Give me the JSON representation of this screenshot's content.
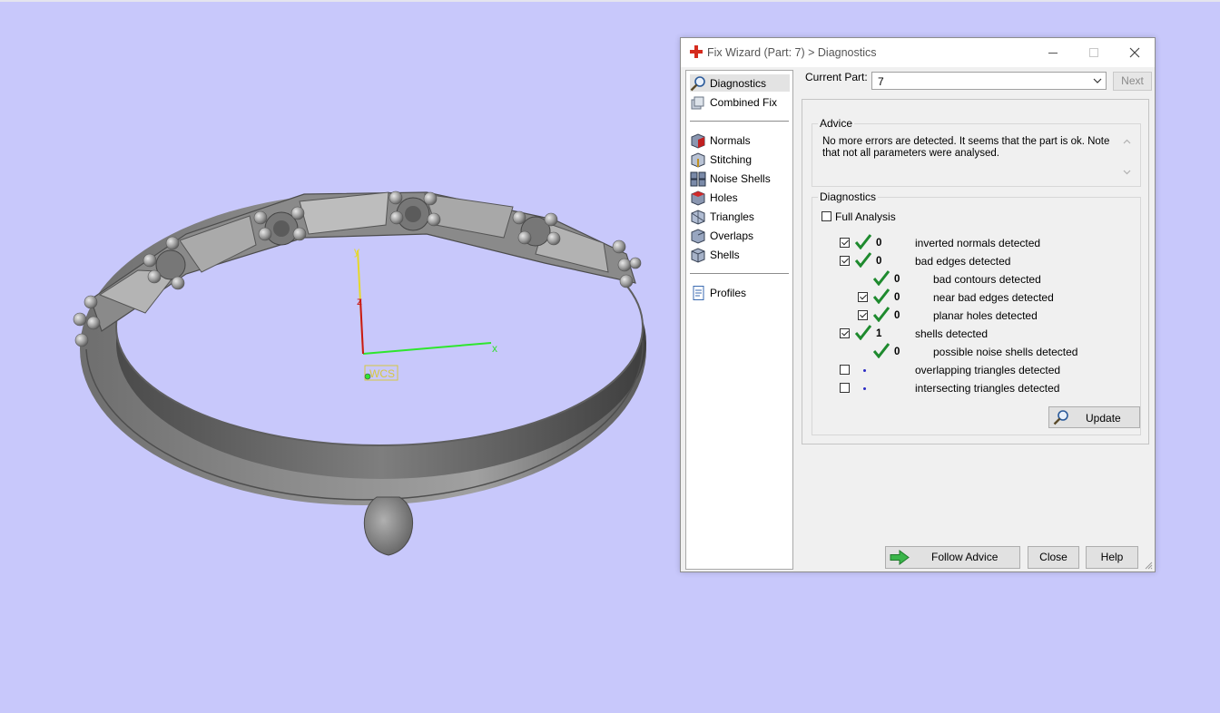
{
  "dialog": {
    "title": "Fix Wizard (Part: 7) > Diagnostics",
    "current_part_label": "Current Part:",
    "current_part_value": "7",
    "next_label": "Next"
  },
  "nav": {
    "items": [
      {
        "label": "Diagnostics",
        "icon": "magnifier-icon",
        "selected": true
      },
      {
        "label": "Combined Fix",
        "icon": "layers-icon"
      },
      {
        "label": "Normals",
        "icon": "normals-cube-icon"
      },
      {
        "label": "Stitching",
        "icon": "stitching-cube-icon"
      },
      {
        "label": "Noise Shells",
        "icon": "noise-shells-icon"
      },
      {
        "label": "Holes",
        "icon": "holes-cube-icon"
      },
      {
        "label": "Triangles",
        "icon": "triangles-cube-icon"
      },
      {
        "label": "Overlaps",
        "icon": "overlaps-cube-icon"
      },
      {
        "label": "Shells",
        "icon": "shells-cube-icon"
      },
      {
        "label": "Profiles",
        "icon": "document-icon"
      }
    ]
  },
  "advice": {
    "title": "Advice",
    "text": "No more errors are detected. It seems that the part is ok. Note that not all parameters were analysed."
  },
  "diagnostics": {
    "title": "Diagnostics",
    "full_analysis_label": "Full Analysis",
    "full_analysis_checked": false,
    "rows": [
      {
        "checked": true,
        "status": "ok",
        "count": "0",
        "label": "inverted normals detected"
      },
      {
        "checked": true,
        "status": "ok",
        "count": "0",
        "label": "bad edges detected"
      },
      {
        "checked": null,
        "status": "ok",
        "count": "0",
        "label": "bad contours detected"
      },
      {
        "checked": true,
        "status": "ok",
        "count": "0",
        "label": "near bad edges detected"
      },
      {
        "checked": true,
        "status": "ok",
        "count": "0",
        "label": "planar holes detected"
      },
      {
        "checked": true,
        "status": "ok",
        "count": "1",
        "label": "shells detected"
      },
      {
        "checked": null,
        "status": "ok",
        "count": "0",
        "label": "possible noise shells detected"
      },
      {
        "checked": false,
        "status": "not-analysed",
        "count": "",
        "label": "overlapping triangles detected"
      },
      {
        "checked": false,
        "status": "not-analysed",
        "count": "",
        "label": "intersecting triangles detected"
      }
    ],
    "update_label": "Update"
  },
  "buttons": {
    "follow_advice": "Follow Advice",
    "close": "Close",
    "help": "Help"
  },
  "viewport": {
    "axis_x": "x",
    "axis_y": "y",
    "axis_z": "z",
    "coord_label": "WCS",
    "background": "#c8c8fb"
  },
  "colors": {
    "check_green": "#1e8a2e",
    "title_icon_red": "#d52b1e",
    "axis_x": "#2ee62e",
    "axis_y": "#e6d82a",
    "axis_z": "#c81818"
  }
}
